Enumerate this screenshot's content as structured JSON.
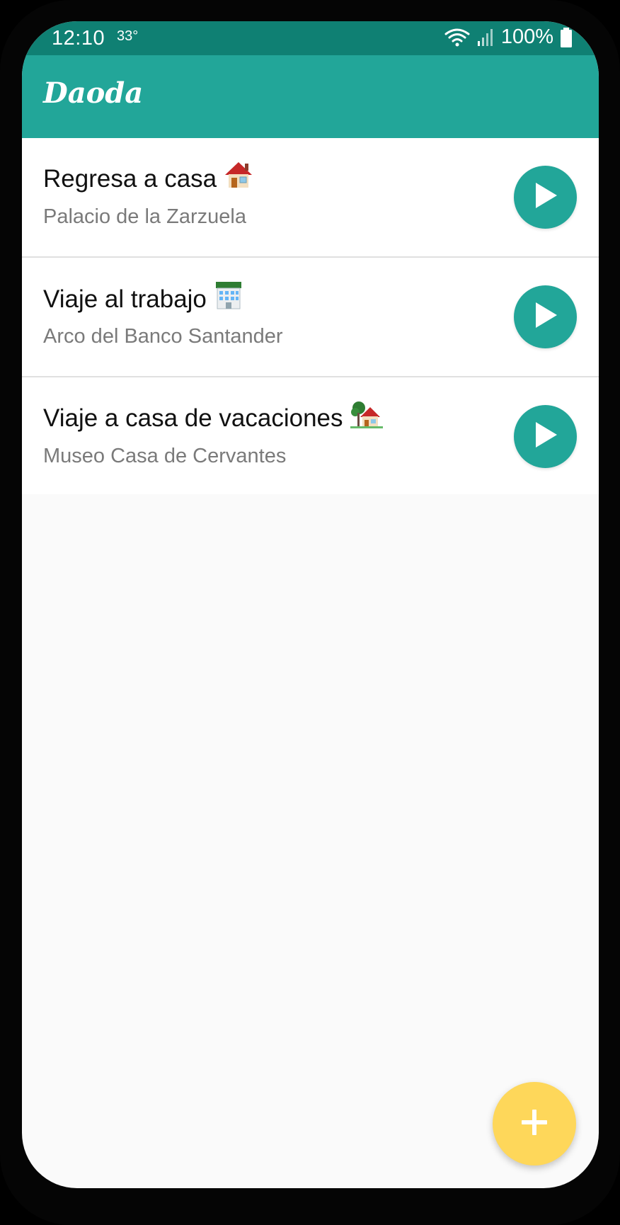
{
  "status_bar": {
    "time": "12:10",
    "temperature": "33°",
    "battery": "100%",
    "icons": [
      "wifi-icon",
      "signal-icon",
      "battery-icon"
    ]
  },
  "app_bar": {
    "title": "Daoda"
  },
  "trips": [
    {
      "title": "Regresa a casa",
      "emoji_icon": "house-icon",
      "subtitle": "Palacio de la Zarzuela",
      "action_icon": "play-icon"
    },
    {
      "title": "Viaje al trabajo",
      "emoji_icon": "bank-icon",
      "subtitle": "Arco del Banco Santander",
      "action_icon": "play-icon"
    },
    {
      "title": "Viaje a casa de vacaciones",
      "emoji_icon": "house-with-garden-icon",
      "subtitle": "Museo Casa de Cervantes",
      "action_icon": "play-icon"
    }
  ],
  "fab": {
    "icon": "plus-icon"
  },
  "colors": {
    "primary": "#22a699",
    "primary_dark": "#0f8073",
    "accent": "#fed75a",
    "background": "#fafafa"
  }
}
